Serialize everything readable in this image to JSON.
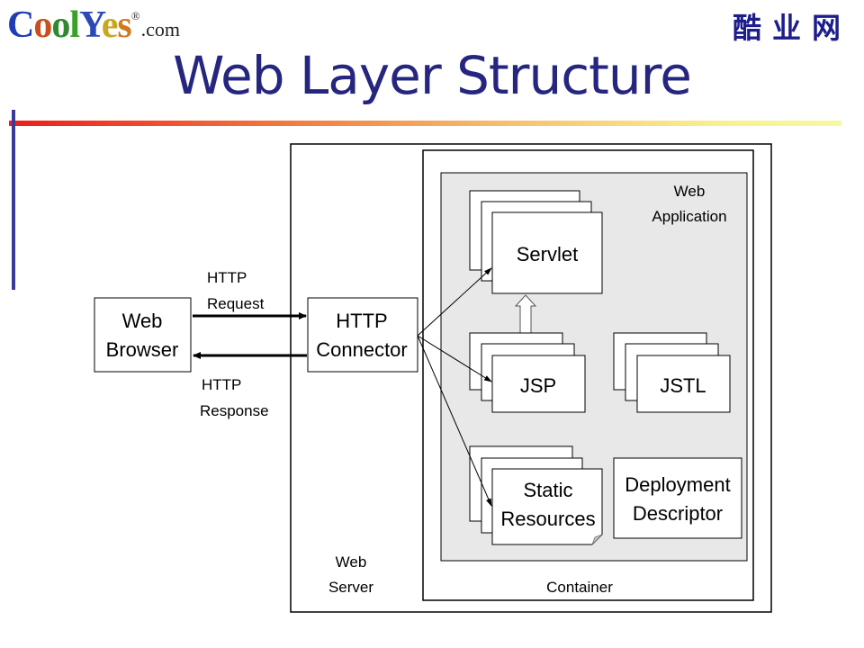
{
  "header": {
    "logo": {
      "letters": [
        {
          "ch": "C",
          "color": "#1f3fb0"
        },
        {
          "ch": "o",
          "color": "#c8501e"
        },
        {
          "ch": "o",
          "color": "#2f8a2f"
        },
        {
          "ch": "l",
          "color": "#3aa02a"
        },
        {
          "ch": "Y",
          "color": "#2c48b8"
        },
        {
          "ch": "e",
          "color": "#c8a81e"
        },
        {
          "ch": "s",
          "color": "#d07a20"
        }
      ],
      "registered": "®",
      "suffix": ".com"
    },
    "chinese_brand": "酷业网",
    "title": "Web Layer Structure"
  },
  "diagram": {
    "web_browser": [
      "Web",
      "Browser"
    ],
    "http_connector": [
      "HTTP",
      "Connector"
    ],
    "http_request": [
      "HTTP",
      "Request"
    ],
    "http_response": [
      "HTTP",
      "Response"
    ],
    "web_server": [
      "Web",
      "Server"
    ],
    "container": "Container",
    "web_application": [
      "Web",
      "Application"
    ],
    "servlet": "Servlet",
    "jsp": "JSP",
    "jstl": "JSTL",
    "static_resources": [
      "Static",
      "Resources"
    ],
    "deployment_descriptor": [
      "Deployment",
      "Descriptor"
    ]
  },
  "colors": {
    "title": "#262680",
    "web_app_fill": "#e8e8e8",
    "line": "#000000"
  }
}
